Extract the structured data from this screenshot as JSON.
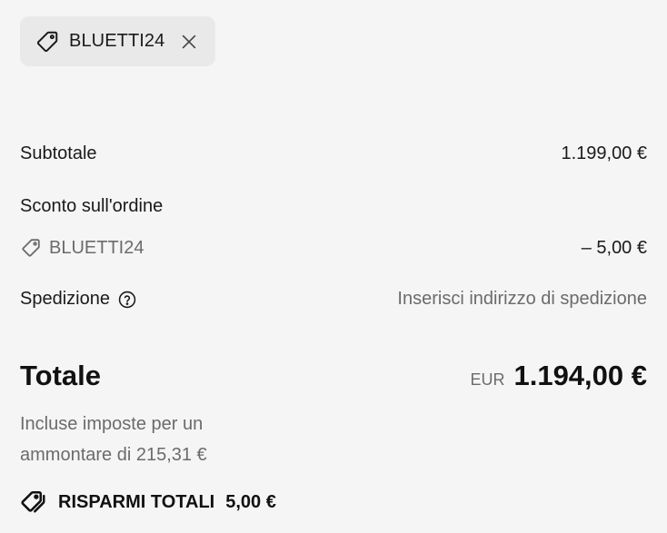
{
  "discount_chip": {
    "code": "BLUETTI24",
    "icon": "tag-icon",
    "remove_icon": "close-icon"
  },
  "summary": {
    "subtotal_label": "Subtotale",
    "subtotal_value": "1.199,00 €",
    "order_discount_label": "Sconto sull'ordine",
    "discount_code": "BLUETTI24",
    "discount_value": "– 5,00 €",
    "shipping_label": "Spedizione",
    "shipping_value": "Inserisci indirizzo di spedizione",
    "shipping_help_icon": "question-circle-icon"
  },
  "total": {
    "label": "Totale",
    "currency": "EUR",
    "amount": "1.194,00 €",
    "taxes_line1": "Incluse imposte per un",
    "taxes_line2": "ammontare di 215,31 €"
  },
  "savings": {
    "label": "RISPARMI TOTALI",
    "value": "5,00 €",
    "icon": "tags-icon"
  },
  "colors": {
    "background": "#f5f5f5",
    "chip_bg": "#e9e9e9",
    "text": "#1a1a1a",
    "muted": "#6b6b6b"
  }
}
